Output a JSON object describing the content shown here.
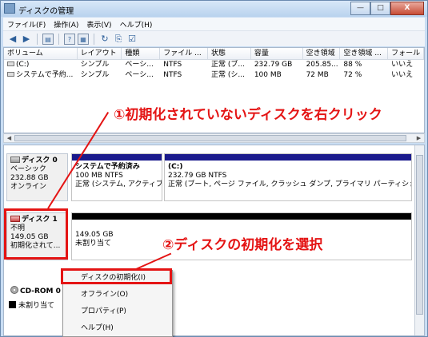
{
  "window": {
    "title": "ディスクの管理",
    "minimize": "—",
    "maximize": "□",
    "close": "X"
  },
  "menu": [
    "ファイル(F)",
    "操作(A)",
    "表示(V)",
    "ヘルプ(H)"
  ],
  "toolbar_icons": [
    "back-icon",
    "forward-icon",
    "console-tree-icon",
    "help-icon",
    "properties-icon",
    "refresh-icon",
    "export-icon",
    "settings-icon"
  ],
  "volume_table": {
    "columns": [
      "ボリューム",
      "レイアウト",
      "種類",
      "ファイル ...",
      "状態",
      "容量",
      "空き領域",
      "空き領域 ...",
      "フォール"
    ],
    "rows": [
      [
        "(C:)",
        "シンプル",
        "ベーシ...",
        "NTFS",
        "正常 (ブ...",
        "232.79 GB",
        "205.85...",
        "88 %",
        "いいえ"
      ],
      [
        "システムで予約...",
        "シンプル",
        "ベーシ...",
        "NTFS",
        "正常 (シ...",
        "100 MB",
        "72 MB",
        "72 %",
        "いいえ"
      ]
    ]
  },
  "disks": [
    {
      "name": "ディスク 0",
      "type": "ベーシック",
      "size": "232.88 GB",
      "status": "オンライン",
      "partitions": [
        {
          "title": "システムで予約済み",
          "size": "100 MB NTFS",
          "status": "正常 (システム, アクティブ"
        },
        {
          "title": "(C:)",
          "size": "232.79 GB NTFS",
          "status": "正常 (ブート, ページ ファイル, クラッシュ ダンプ, プライマリ パーティション"
        }
      ]
    },
    {
      "name": "ディスク 1",
      "type": "不明",
      "size": "149.05 GB",
      "status": "初期化されて...",
      "partitions": [
        {
          "size": "149.05 GB",
          "status": "未割り当て"
        }
      ]
    },
    {
      "name": "CD-ROM 0"
    }
  ],
  "legend": {
    "label": "未割り当て",
    "color": "#000000"
  },
  "context_menu": {
    "items": [
      "ディスクの初期化(I)",
      "オフライン(O)",
      "プロパティ(P)",
      "ヘルプ(H)"
    ]
  },
  "annotations": {
    "step1": "①初期化されていないディスクを右クリック",
    "step2": "②ディスクの初期化を選択",
    "color": "#e41414"
  }
}
